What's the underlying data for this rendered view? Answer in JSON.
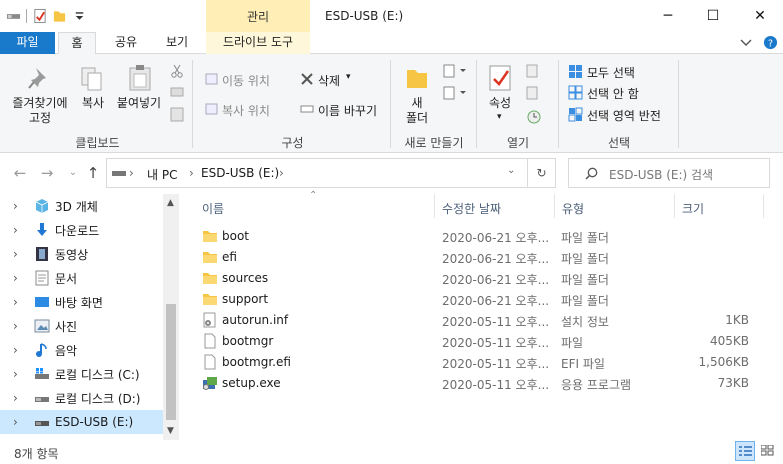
{
  "window": {
    "title": "ESD-USB (E:)",
    "context_tab_group": "관리",
    "controls": {
      "minimize": "─",
      "maximize": "☐",
      "close": "✕"
    }
  },
  "tabs": {
    "file": "파일",
    "home": "홈",
    "share": "공유",
    "view": "보기",
    "drive_tools": "드라이브 도구"
  },
  "ribbon": {
    "clipboard": {
      "pin": "즐겨찾기에\n고정",
      "copy": "복사",
      "paste": "붙여넣기",
      "label": "클립보드"
    },
    "organize": {
      "move_to": "이동 위치",
      "copy_to": "복사 위치",
      "delete": "삭제",
      "rename": "이름 바꾸기",
      "label": "구성"
    },
    "new": {
      "new_folder": "새\n폴더",
      "label": "새로 만들기"
    },
    "open": {
      "properties": "속성",
      "label": "열기"
    },
    "select": {
      "select_all": "모두 선택",
      "select_none": "선택 안 함",
      "invert": "선택 영역 반전",
      "label": "선택"
    }
  },
  "address": {
    "segments": [
      "내 PC",
      "ESD-USB (E:)"
    ],
    "search_placeholder": "ESD-USB (E:) 검색"
  },
  "nav_pane": {
    "items": [
      {
        "label": "3D 개체",
        "icon": "cube-3d-icon"
      },
      {
        "label": "다운로드",
        "icon": "download-arrow-icon"
      },
      {
        "label": "동영상",
        "icon": "film-icon"
      },
      {
        "label": "문서",
        "icon": "document-icon"
      },
      {
        "label": "바탕 화면",
        "icon": "desktop-icon"
      },
      {
        "label": "사진",
        "icon": "pictures-icon"
      },
      {
        "label": "음악",
        "icon": "music-note-icon"
      },
      {
        "label": "로컬 디스크 (C:)",
        "icon": "windows-drive-icon"
      },
      {
        "label": "로컬 디스크 (D:)",
        "icon": "drive-icon"
      },
      {
        "label": "ESD-USB (E:)",
        "icon": "usb-drive-icon",
        "selected": true
      }
    ]
  },
  "columns": {
    "name": "이름",
    "date": "수정한 날짜",
    "type": "유형",
    "size": "크기"
  },
  "files": [
    {
      "name": "boot",
      "date": "2020-06-21 오후...",
      "type": "파일 폴더",
      "size": "",
      "icon": "folder-icon"
    },
    {
      "name": "efi",
      "date": "2020-06-21 오후...",
      "type": "파일 폴더",
      "size": "",
      "icon": "folder-icon"
    },
    {
      "name": "sources",
      "date": "2020-06-21 오후...",
      "type": "파일 폴더",
      "size": "",
      "icon": "folder-icon"
    },
    {
      "name": "support",
      "date": "2020-06-21 오후...",
      "type": "파일 폴더",
      "size": "",
      "icon": "folder-icon"
    },
    {
      "name": "autorun.inf",
      "date": "2020-05-11 오후...",
      "type": "설치 정보",
      "size": "1KB",
      "icon": "settings-file-icon"
    },
    {
      "name": "bootmgr",
      "date": "2020-05-11 오후...",
      "type": "파일",
      "size": "405KB",
      "icon": "file-icon"
    },
    {
      "name": "bootmgr.efi",
      "date": "2020-05-11 오후...",
      "type": "EFI 파일",
      "size": "1,506KB",
      "icon": "file-icon"
    },
    {
      "name": "setup.exe",
      "date": "2020-05-11 오후...",
      "type": "응용 프로그램",
      "size": "73KB",
      "icon": "setup-exe-icon"
    }
  ],
  "status": {
    "item_count": "8개 항목"
  }
}
